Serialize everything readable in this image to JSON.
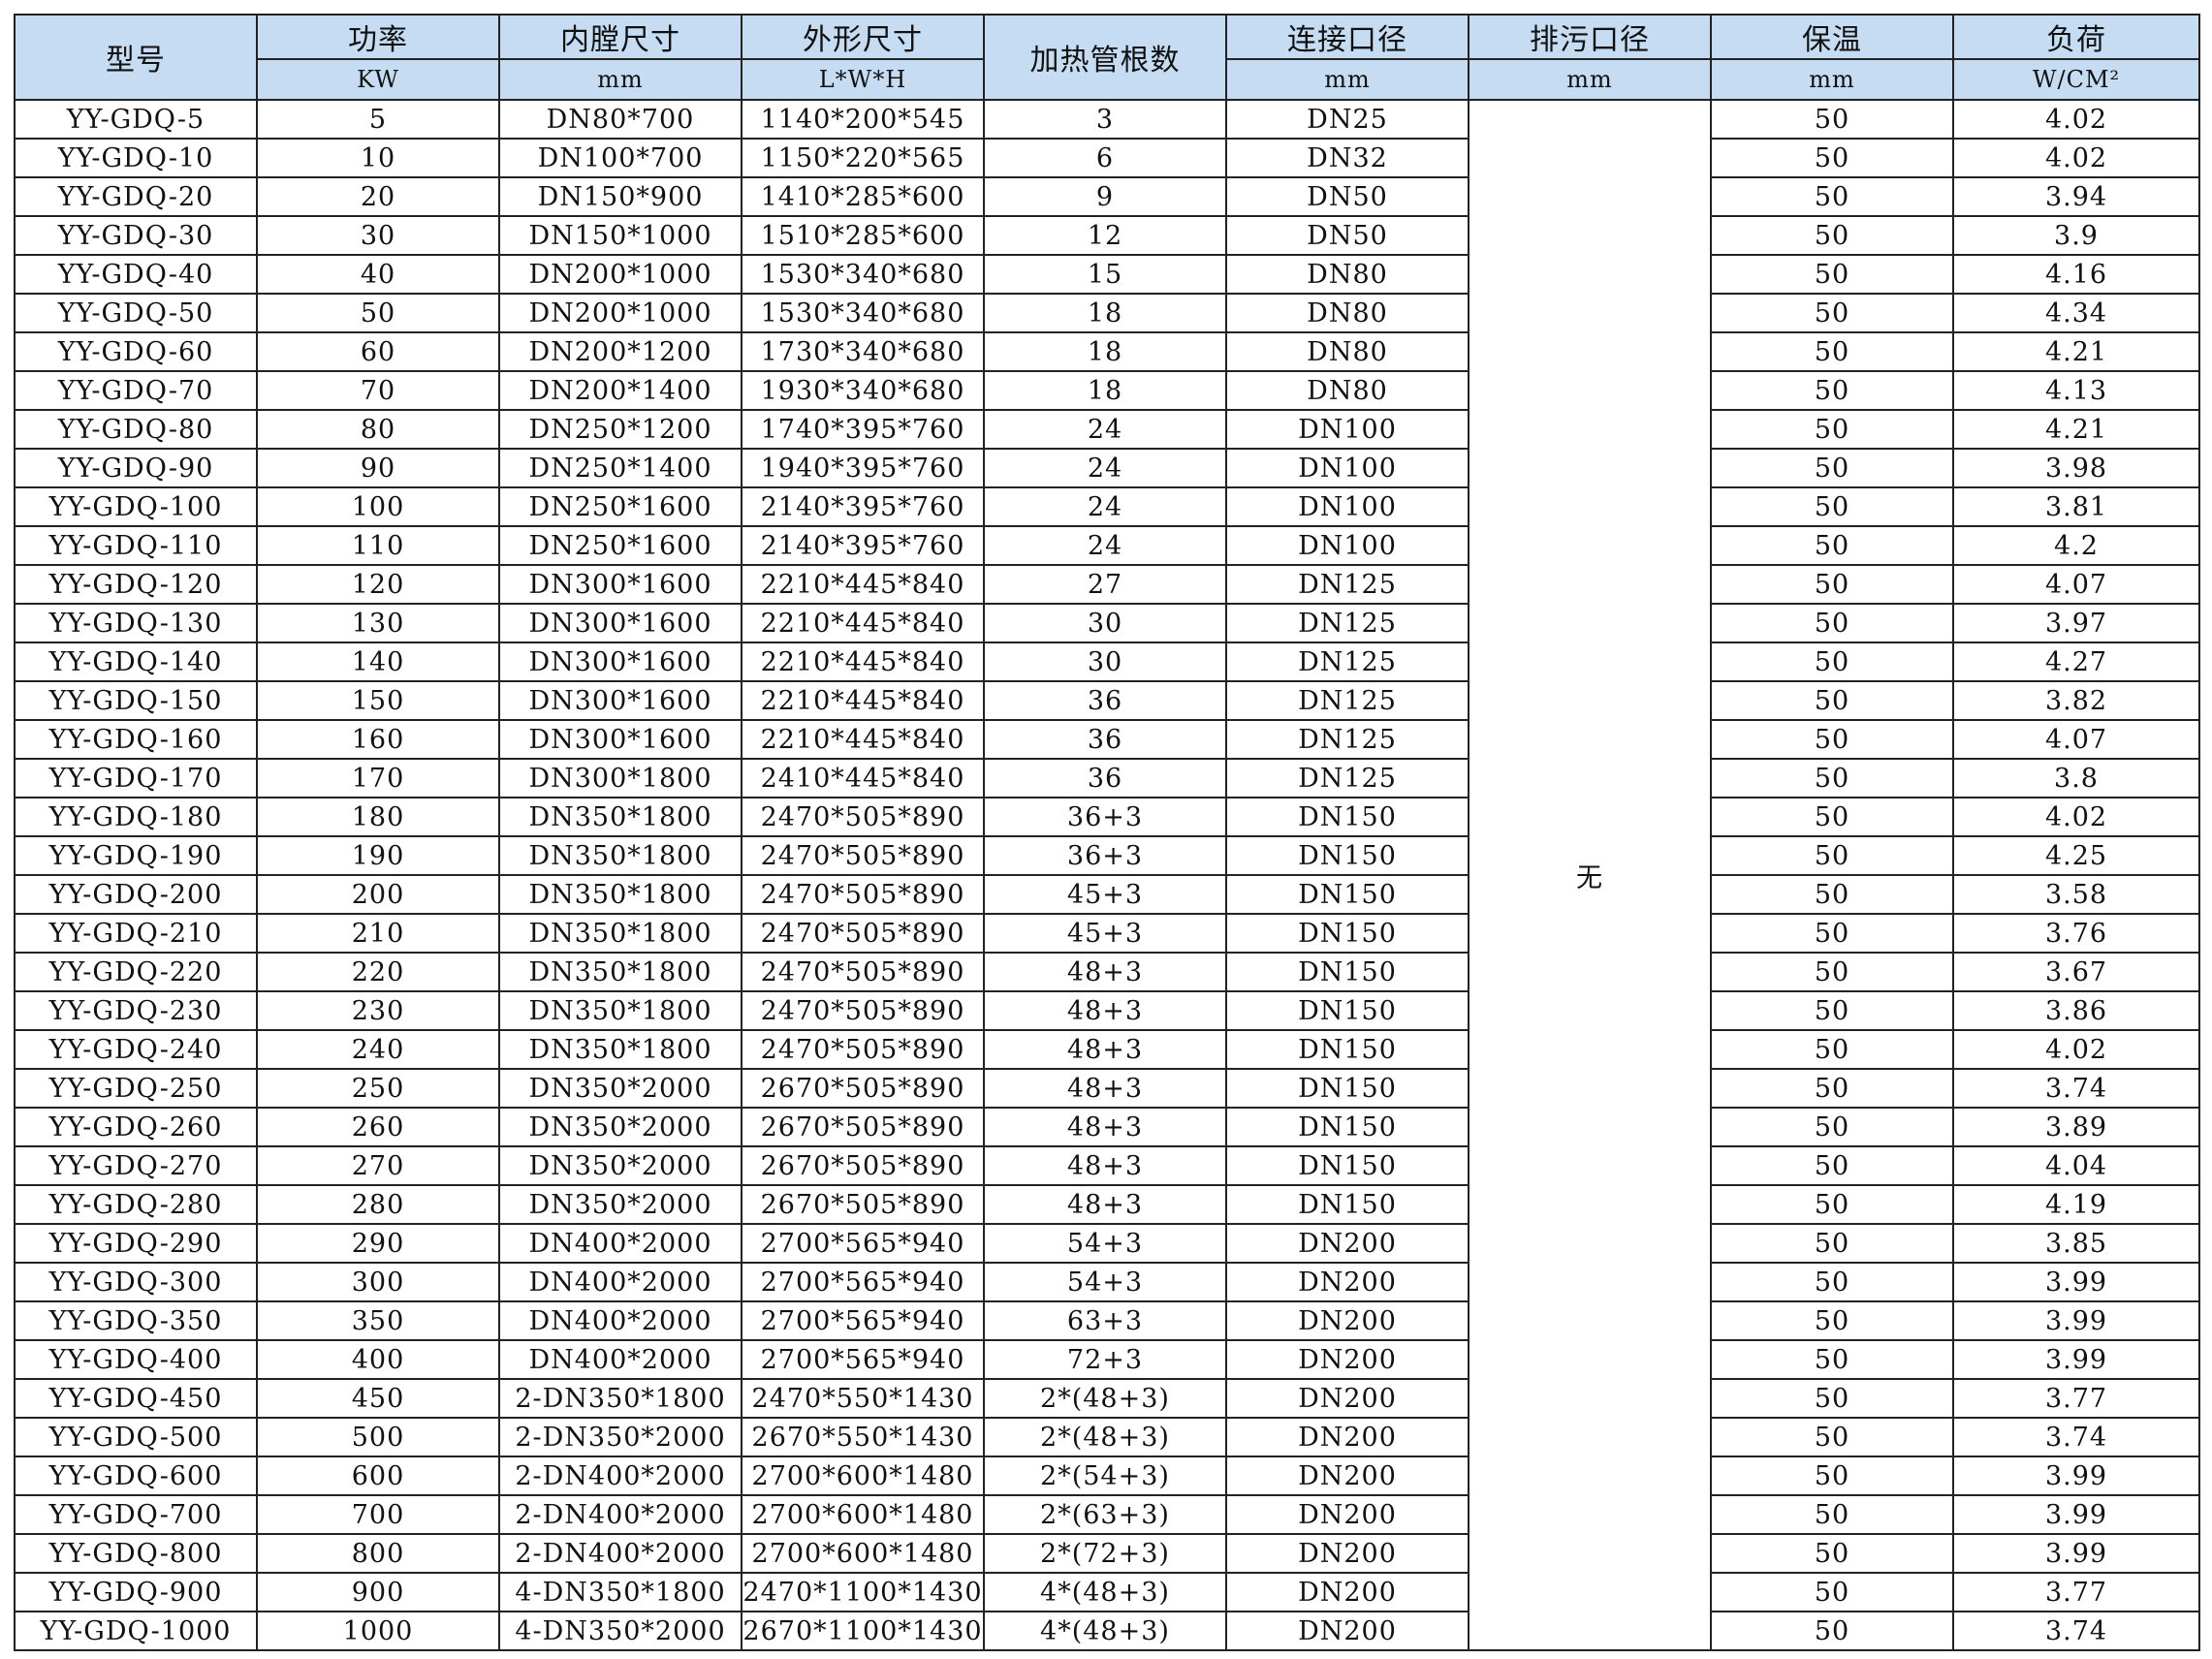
{
  "table": {
    "headers": {
      "model": "型号",
      "power": "功率",
      "power_unit": "KW",
      "inner": "内膛尺寸",
      "inner_unit": "mm",
      "outer": "外形尺寸",
      "outer_unit": "L*W*H",
      "tubes": "加热管根数",
      "conn": "连接口径",
      "conn_unit": "mm",
      "drain": "排污口径",
      "drain_unit": "mm",
      "insul": "保温",
      "insul_unit": "mm",
      "load": "负荷",
      "load_unit": "W/CM²"
    },
    "drain_value": "无",
    "rows": [
      [
        "YY-GDQ-5",
        "5",
        "DN80*700",
        "1140*200*545",
        "3",
        "DN25",
        "50",
        "4.02"
      ],
      [
        "YY-GDQ-10",
        "10",
        "DN100*700",
        "1150*220*565",
        "6",
        "DN32",
        "50",
        "4.02"
      ],
      [
        "YY-GDQ-20",
        "20",
        "DN150*900",
        "1410*285*600",
        "9",
        "DN50",
        "50",
        "3.94"
      ],
      [
        "YY-GDQ-30",
        "30",
        "DN150*1000",
        "1510*285*600",
        "12",
        "DN50",
        "50",
        "3.9"
      ],
      [
        "YY-GDQ-40",
        "40",
        "DN200*1000",
        "1530*340*680",
        "15",
        "DN80",
        "50",
        "4.16"
      ],
      [
        "YY-GDQ-50",
        "50",
        "DN200*1000",
        "1530*340*680",
        "18",
        "DN80",
        "50",
        "4.34"
      ],
      [
        "YY-GDQ-60",
        "60",
        "DN200*1200",
        "1730*340*680",
        "18",
        "DN80",
        "50",
        "4.21"
      ],
      [
        "YY-GDQ-70",
        "70",
        "DN200*1400",
        "1930*340*680",
        "18",
        "DN80",
        "50",
        "4.13"
      ],
      [
        "YY-GDQ-80",
        "80",
        "DN250*1200",
        "1740*395*760",
        "24",
        "DN100",
        "50",
        "4.21"
      ],
      [
        "YY-GDQ-90",
        "90",
        "DN250*1400",
        "1940*395*760",
        "24",
        "DN100",
        "50",
        "3.98"
      ],
      [
        "YY-GDQ-100",
        "100",
        "DN250*1600",
        "2140*395*760",
        "24",
        "DN100",
        "50",
        "3.81"
      ],
      [
        "YY-GDQ-110",
        "110",
        "DN250*1600",
        "2140*395*760",
        "24",
        "DN100",
        "50",
        "4.2"
      ],
      [
        "YY-GDQ-120",
        "120",
        "DN300*1600",
        "2210*445*840",
        "27",
        "DN125",
        "50",
        "4.07"
      ],
      [
        "YY-GDQ-130",
        "130",
        "DN300*1600",
        "2210*445*840",
        "30",
        "DN125",
        "50",
        "3.97"
      ],
      [
        "YY-GDQ-140",
        "140",
        "DN300*1600",
        "2210*445*840",
        "30",
        "DN125",
        "50",
        "4.27"
      ],
      [
        "YY-GDQ-150",
        "150",
        "DN300*1600",
        "2210*445*840",
        "36",
        "DN125",
        "50",
        "3.82"
      ],
      [
        "YY-GDQ-160",
        "160",
        "DN300*1600",
        "2210*445*840",
        "36",
        "DN125",
        "50",
        "4.07"
      ],
      [
        "YY-GDQ-170",
        "170",
        "DN300*1800",
        "2410*445*840",
        "36",
        "DN125",
        "50",
        "3.8"
      ],
      [
        "YY-GDQ-180",
        "180",
        "DN350*1800",
        "2470*505*890",
        "36+3",
        "DN150",
        "50",
        "4.02"
      ],
      [
        "YY-GDQ-190",
        "190",
        "DN350*1800",
        "2470*505*890",
        "36+3",
        "DN150",
        "50",
        "4.25"
      ],
      [
        "YY-GDQ-200",
        "200",
        "DN350*1800",
        "2470*505*890",
        "45+3",
        "DN150",
        "50",
        "3.58"
      ],
      [
        "YY-GDQ-210",
        "210",
        "DN350*1800",
        "2470*505*890",
        "45+3",
        "DN150",
        "50",
        "3.76"
      ],
      [
        "YY-GDQ-220",
        "220",
        "DN350*1800",
        "2470*505*890",
        "48+3",
        "DN150",
        "50",
        "3.67"
      ],
      [
        "YY-GDQ-230",
        "230",
        "DN350*1800",
        "2470*505*890",
        "48+3",
        "DN150",
        "50",
        "3.86"
      ],
      [
        "YY-GDQ-240",
        "240",
        "DN350*1800",
        "2470*505*890",
        "48+3",
        "DN150",
        "50",
        "4.02"
      ],
      [
        "YY-GDQ-250",
        "250",
        "DN350*2000",
        "2670*505*890",
        "48+3",
        "DN150",
        "50",
        "3.74"
      ],
      [
        "YY-GDQ-260",
        "260",
        "DN350*2000",
        "2670*505*890",
        "48+3",
        "DN150",
        "50",
        "3.89"
      ],
      [
        "YY-GDQ-270",
        "270",
        "DN350*2000",
        "2670*505*890",
        "48+3",
        "DN150",
        "50",
        "4.04"
      ],
      [
        "YY-GDQ-280",
        "280",
        "DN350*2000",
        "2670*505*890",
        "48+3",
        "DN150",
        "50",
        "4.19"
      ],
      [
        "YY-GDQ-290",
        "290",
        "DN400*2000",
        "2700*565*940",
        "54+3",
        "DN200",
        "50",
        "3.85"
      ],
      [
        "YY-GDQ-300",
        "300",
        "DN400*2000",
        "2700*565*940",
        "54+3",
        "DN200",
        "50",
        "3.99"
      ],
      [
        "YY-GDQ-350",
        "350",
        "DN400*2000",
        "2700*565*940",
        "63+3",
        "DN200",
        "50",
        "3.99"
      ],
      [
        "YY-GDQ-400",
        "400",
        "DN400*2000",
        "2700*565*940",
        "72+3",
        "DN200",
        "50",
        "3.99"
      ],
      [
        "YY-GDQ-450",
        "450",
        "2-DN350*1800",
        "2470*550*1430",
        "2*(48+3)",
        "DN200",
        "50",
        "3.77"
      ],
      [
        "YY-GDQ-500",
        "500",
        "2-DN350*2000",
        "2670*550*1430",
        "2*(48+3)",
        "DN200",
        "50",
        "3.74"
      ],
      [
        "YY-GDQ-600",
        "600",
        "2-DN400*2000",
        "2700*600*1480",
        "2*(54+3)",
        "DN200",
        "50",
        "3.99"
      ],
      [
        "YY-GDQ-700",
        "700",
        "2-DN400*2000",
        "2700*600*1480",
        "2*(63+3)",
        "DN200",
        "50",
        "3.99"
      ],
      [
        "YY-GDQ-800",
        "800",
        "2-DN400*2000",
        "2700*600*1480",
        "2*(72+3)",
        "DN200",
        "50",
        "3.99"
      ],
      [
        "YY-GDQ-900",
        "900",
        "4-DN350*1800",
        "2470*1100*1430",
        "4*(48+3)",
        "DN200",
        "50",
        "3.77"
      ],
      [
        "YY-GDQ-1000",
        "1000",
        "4-DN350*2000",
        "2670*1100*1430",
        "4*(48+3)",
        "DN200",
        "50",
        "3.74"
      ]
    ]
  }
}
